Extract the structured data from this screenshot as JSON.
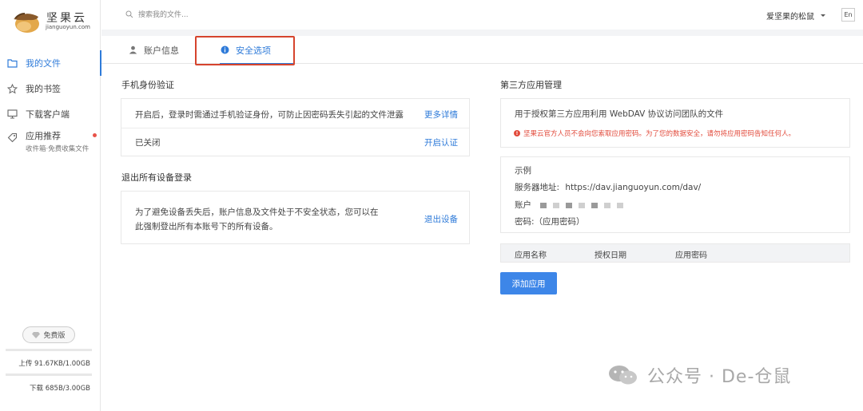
{
  "app": {
    "brand": "坚果云",
    "domain": "jianguoyun.com"
  },
  "sidebar": {
    "items": [
      {
        "label": "我的文件",
        "icon": "folder-icon"
      },
      {
        "label": "我的书签",
        "icon": "star-icon"
      },
      {
        "label": "下载客户端",
        "icon": "monitor-icon"
      },
      {
        "label": "应用推荐",
        "sub": "收件箱·免费收集文件",
        "icon": "tag-icon"
      }
    ],
    "plan_label": "免费版",
    "upload_text": "上传 91.67KB/1.00GB",
    "download_text": "下载 685B/3.00GB"
  },
  "topbar": {
    "search_placeholder": "搜索我的文件...",
    "username": "爱坚果的松鼠",
    "lang": "En"
  },
  "tabs": [
    {
      "label": "账户信息",
      "icon": "person-icon"
    },
    {
      "label": "安全选项",
      "icon": "info-icon"
    }
  ],
  "phone_verify": {
    "title": "手机身份验证",
    "desc": "开启后，登录时需通过手机验证身份，可防止因密码丢失引起的文件泄露",
    "more_link": "更多详情",
    "status": "已关闭",
    "enable_link": "开启认证"
  },
  "logout_all": {
    "title": "退出所有设备登录",
    "desc_line1": "为了避免设备丢失后，账户信息及文件处于不安全状态，您可以在",
    "desc_line2": "此强制登出所有本账号下的所有设备。",
    "action_link": "退出设备"
  },
  "third_party": {
    "title": "第三方应用管理",
    "desc": "用于授权第三方应用利用 WebDAV 协议访问团队的文件",
    "warning": "坚果云官方人员不会向您索取应用密码。为了您的数据安全，请勿将应用密码告知任何人。",
    "example_title": "示例",
    "server_label": "服务器地址:",
    "server_url": "https://dav.jianguoyun.com/dav/",
    "account_label": "账户",
    "password_text": "密码:（应用密码）",
    "columns": [
      "应用名称",
      "授权日期",
      "应用密码"
    ],
    "add_button": "添加应用"
  },
  "watermark": "公众号 · De-仓鼠"
}
